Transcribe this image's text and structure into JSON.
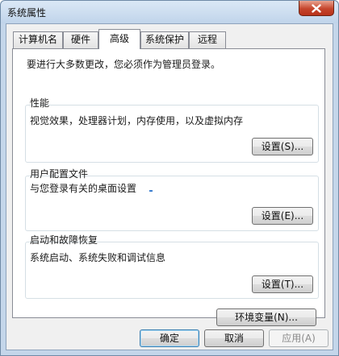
{
  "window": {
    "title": "系统属性"
  },
  "tabs": [
    {
      "label": "计算机名"
    },
    {
      "label": "硬件"
    },
    {
      "label": "高级"
    },
    {
      "label": "系统保护"
    },
    {
      "label": "远程"
    }
  ],
  "notice": "要进行大多数更改，您必须作为管理员登录。",
  "groups": {
    "performance": {
      "title": "性能",
      "description": "视觉效果，处理器计划，内存使用，以及虚拟内存",
      "button": "设置(S)..."
    },
    "user_profiles": {
      "title": "用户配置文件",
      "description": "与您登录有关的桌面设置",
      "button": "设置(E)..."
    },
    "startup_recovery": {
      "title": "启动和故障恢复",
      "description": "系统启动、系统失败和调试信息",
      "button": "设置(T)..."
    }
  },
  "env_button": "环境变量(N)...",
  "footer": {
    "ok": "确定",
    "cancel": "取消",
    "apply": "应用(A)"
  },
  "icons": {
    "close": "close-icon"
  },
  "colors": {
    "close_button": "#c5452c",
    "frame": "#c4d6ea"
  }
}
